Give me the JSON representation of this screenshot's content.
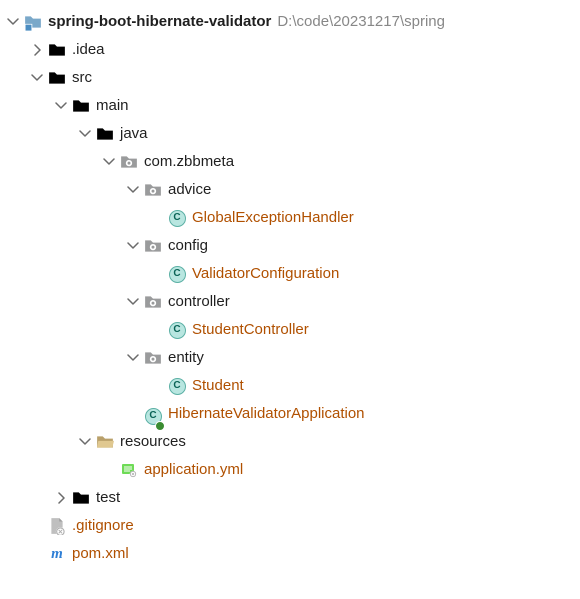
{
  "root": {
    "name": "spring-boot-hibernate-validator",
    "path": "D:\\code\\20231217\\spring"
  },
  "nodes": {
    "idea": ".idea",
    "src": "src",
    "main": "main",
    "java": "java",
    "pkg": "com.zbbmeta",
    "advice": "advice",
    "geh": "GlobalExceptionHandler",
    "config": "config",
    "vc": "ValidatorConfiguration",
    "controller": "controller",
    "sc": "StudentController",
    "entity": "entity",
    "student": "Student",
    "hva": "HibernateValidatorApplication",
    "resources": "resources",
    "appyml": "application.yml",
    "test": "test",
    "gitignore": ".gitignore",
    "pom": "pom.xml"
  }
}
